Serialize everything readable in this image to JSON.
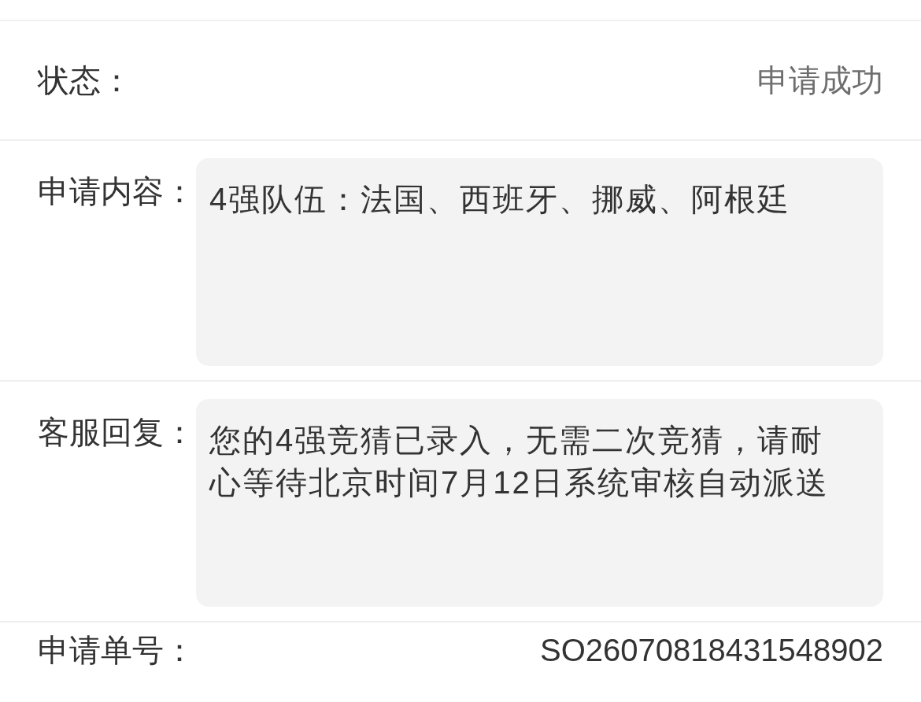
{
  "rows": [
    {
      "kind": "status",
      "label": "状态：",
      "value": "申请成功"
    },
    {
      "kind": "textbox",
      "label": "申请内容：",
      "value": "4强队伍：法国、西班牙、挪威、阿根廷"
    },
    {
      "kind": "textbox",
      "label": "客服回复：",
      "value": "您的4强竞猜已录入，无需二次竞猜，请耐心等待北京时间7月12日系统审核自动派送"
    },
    {
      "kind": "number",
      "label": "申请单号：",
      "value": "SO26070818431548902"
    }
  ]
}
